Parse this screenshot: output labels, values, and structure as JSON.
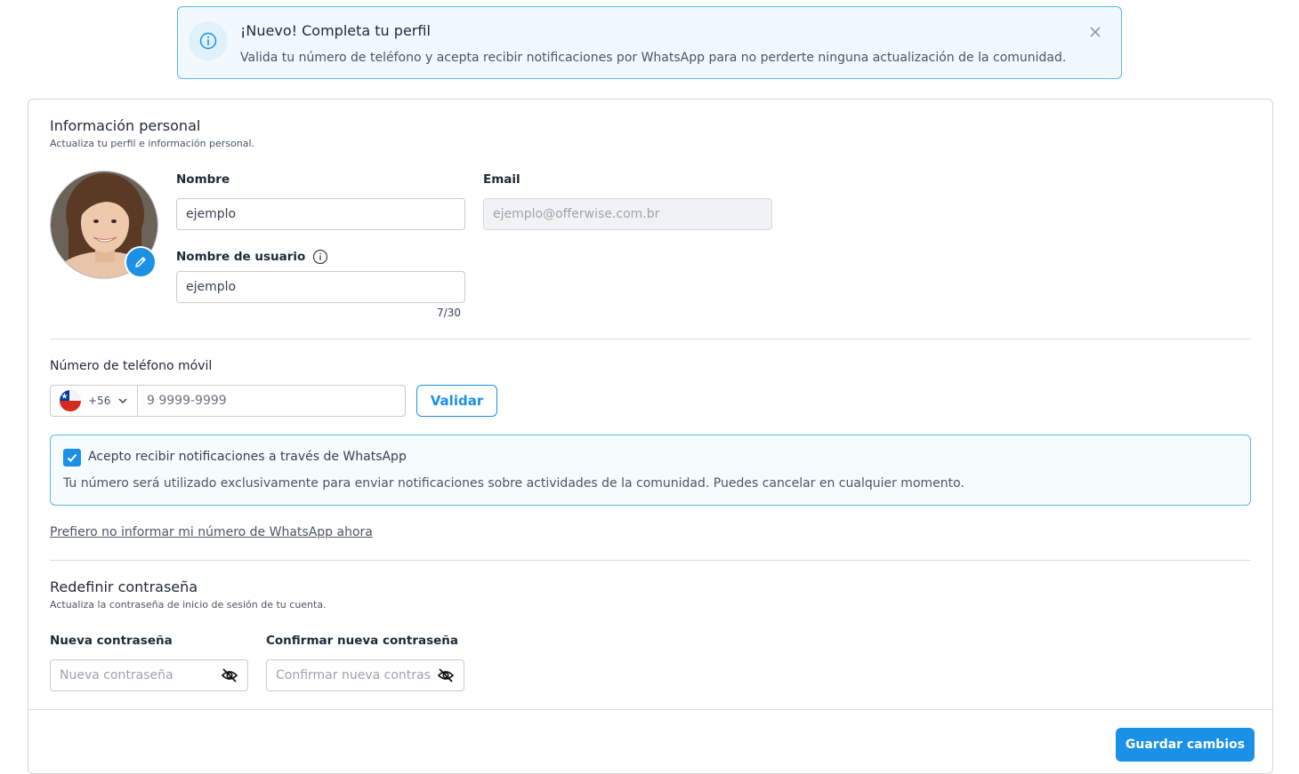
{
  "banner": {
    "title": "¡Nuevo! Completa tu perfil",
    "text": "Valida tu número de teléfono y acepta recibir notificaciones por WhatsApp para no perderte ninguna actualización de la comunidad."
  },
  "personal": {
    "title": "Información personal",
    "subtitle": "Actualiza tu perfil e información personal.",
    "name_label": "Nombre",
    "name_value": "ejemplo",
    "email_label": "Email",
    "email_value": "ejemplo@offerwise.com.br",
    "username_label": "Nombre de usuario",
    "username_value": "ejemplo",
    "username_counter": "7/30"
  },
  "phone": {
    "label": "Número de teléfono móvil",
    "country_code": "+56",
    "placeholder": "9 9999-9999",
    "validate_label": "Validar"
  },
  "whatsapp": {
    "checkbox_label": "Acepto recibir notificaciones a través de WhatsApp",
    "checked": true,
    "note": "Tu número será utilizado exclusivamente para enviar notificaciones sobre actividades de la comunidad. Puedes cancelar en cualquier momento.",
    "skip_link": "Prefiero no informar mi número de WhatsApp ahora"
  },
  "password": {
    "title": "Redefinir contraseña",
    "subtitle": "Actualiza la contraseña de inicio de sesión de tu cuenta.",
    "new_label": "Nueva contraseña",
    "new_placeholder": "Nueva contraseña",
    "confirm_label": "Confirmar nueva contraseña",
    "confirm_placeholder": "Confirmar nueva contras"
  },
  "footer": {
    "save_label": "Guardar cambios"
  },
  "colors": {
    "accent": "#1a91e6",
    "banner_border": "#5bb8ef",
    "banner_bg": "#f1f9fe"
  },
  "icons": [
    "info-icon",
    "close-icon",
    "pencil-icon",
    "chile-flag-icon",
    "chevron-down-icon",
    "check-icon",
    "eye-off-icon"
  ]
}
